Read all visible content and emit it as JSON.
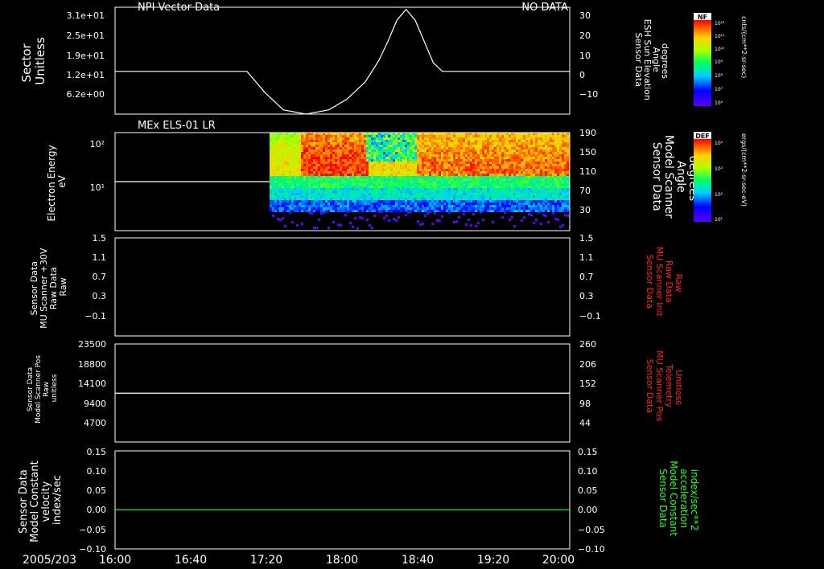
{
  "colors": {
    "background": "#000000",
    "axis": "#ffffff",
    "red_label": "#ff2020",
    "green_label": "#20ff20"
  },
  "time_axis": {
    "date_label": "2005/203",
    "ticks": [
      "16:00",
      "16:40",
      "17:20",
      "18:00",
      "18:40",
      "19:20",
      "20:00"
    ]
  },
  "chart_data": [
    {
      "type": "line",
      "panel_title": "NPI Vector Data",
      "status": "NO DATA",
      "ylabel_left": [
        "Sector",
        "Unitless"
      ],
      "yticks_left": [
        "3.1e+01",
        "2.5e+01",
        "1.9e+01",
        "1.2e+01",
        "6.2e+00"
      ],
      "ylabel_right": [
        "Sensor Data",
        "ESH Sun Elevation",
        "Angle",
        "degrees"
      ],
      "yticks_right": [
        "30",
        "20",
        "10",
        "0",
        "−10"
      ],
      "ylim_right": [
        -20,
        30
      ],
      "series": [
        {
          "x": [
            0,
            0.29,
            0.33,
            0.37,
            0.42,
            0.47,
            0.51,
            0.55,
            0.58,
            0.6,
            0.62,
            0.64,
            0.66,
            0.68,
            0.7,
            0.72,
            1.0
          ],
          "values": [
            0,
            0,
            -10,
            -18,
            -20,
            -18,
            -13,
            -5,
            5,
            14,
            24,
            29,
            24,
            14,
            4,
            0,
            0
          ]
        }
      ]
    },
    {
      "type": "heatmap",
      "panel_title": "MEx ELS-01 LR",
      "ylabel_left": [
        "Electron Energy",
        "eV"
      ],
      "yticks_left": [
        "10²",
        "10¹"
      ],
      "ylabel_right": [
        "Sensor Data",
        "Model Scanner",
        "Angle",
        "degrees"
      ],
      "yticks_right": [
        "190",
        "150",
        "110",
        "70",
        "30"
      ],
      "ylim_right": [
        -10,
        190
      ],
      "data_start_fraction": 0.34,
      "scanner_angle_series": {
        "x": [
          0,
          0.34
        ],
        "values": [
          90,
          90
        ]
      }
    },
    {
      "type": "line",
      "ylabel_left": [
        "Sensor Data",
        "MU Scanner +30V",
        "Raw Data",
        "Raw"
      ],
      "yticks_left": [
        "1.5",
        "1.1",
        "0.7",
        "0.3",
        "−0.1"
      ],
      "ylabel_right": [
        "Sensor Data",
        "MU Scanner Init",
        "Raw Data",
        "Raw"
      ],
      "yticks_right": [
        "1.5",
        "1.1",
        "0.7",
        "0.3",
        "−0.1"
      ],
      "ylim": [
        -0.3,
        1.5
      ],
      "series": []
    },
    {
      "type": "line",
      "ylabel_left": [
        "Sensor Data",
        "Model Scanner Pos",
        "Raw",
        "unitless"
      ],
      "yticks_left": [
        "23500",
        "18800",
        "14100",
        "9400",
        "4700"
      ],
      "ylabel_right": [
        "Sensor Data",
        "MU Scanner Pos",
        "Telemetry",
        "Unitless"
      ],
      "yticks_right": [
        "260",
        "206",
        "152",
        "98",
        "44"
      ],
      "ylim_left": [
        0,
        23500
      ],
      "series": [
        {
          "x": [
            0,
            1
          ],
          "values": [
            11700,
            11700
          ]
        }
      ]
    },
    {
      "type": "line",
      "ylabel_left": [
        "Sensor Data",
        "Model Constant",
        "velocity",
        "index/sec"
      ],
      "yticks_left": [
        "0.15",
        "0.10",
        "0.05",
        "0.00",
        "−0.05",
        "−0.10"
      ],
      "ylabel_right": [
        "Sensor Data",
        "Model Constant",
        "acceleration",
        "index/sec**2"
      ],
      "yticks_right": [
        "0.15",
        "0.10",
        "0.05",
        "0.00",
        "−0.05",
        "−0.10"
      ],
      "ylim": [
        -0.1,
        0.15
      ],
      "series": [
        {
          "x": [
            0,
            1
          ],
          "values": [
            0,
            0
          ]
        }
      ]
    }
  ],
  "colorbars": [
    {
      "label": "NF",
      "unit": "cnts/(cm**2-sr-sec)",
      "ticks": [
        "10¹²",
        "10¹¹",
        "10¹⁰",
        "10⁹",
        "10⁸",
        "10⁷",
        "10⁶"
      ]
    },
    {
      "label": "DEF",
      "unit": "ergs/(cm**2-sr-sec-eV)",
      "ticks": [
        "10⁴",
        "10³",
        "10²",
        "10¹"
      ]
    }
  ]
}
